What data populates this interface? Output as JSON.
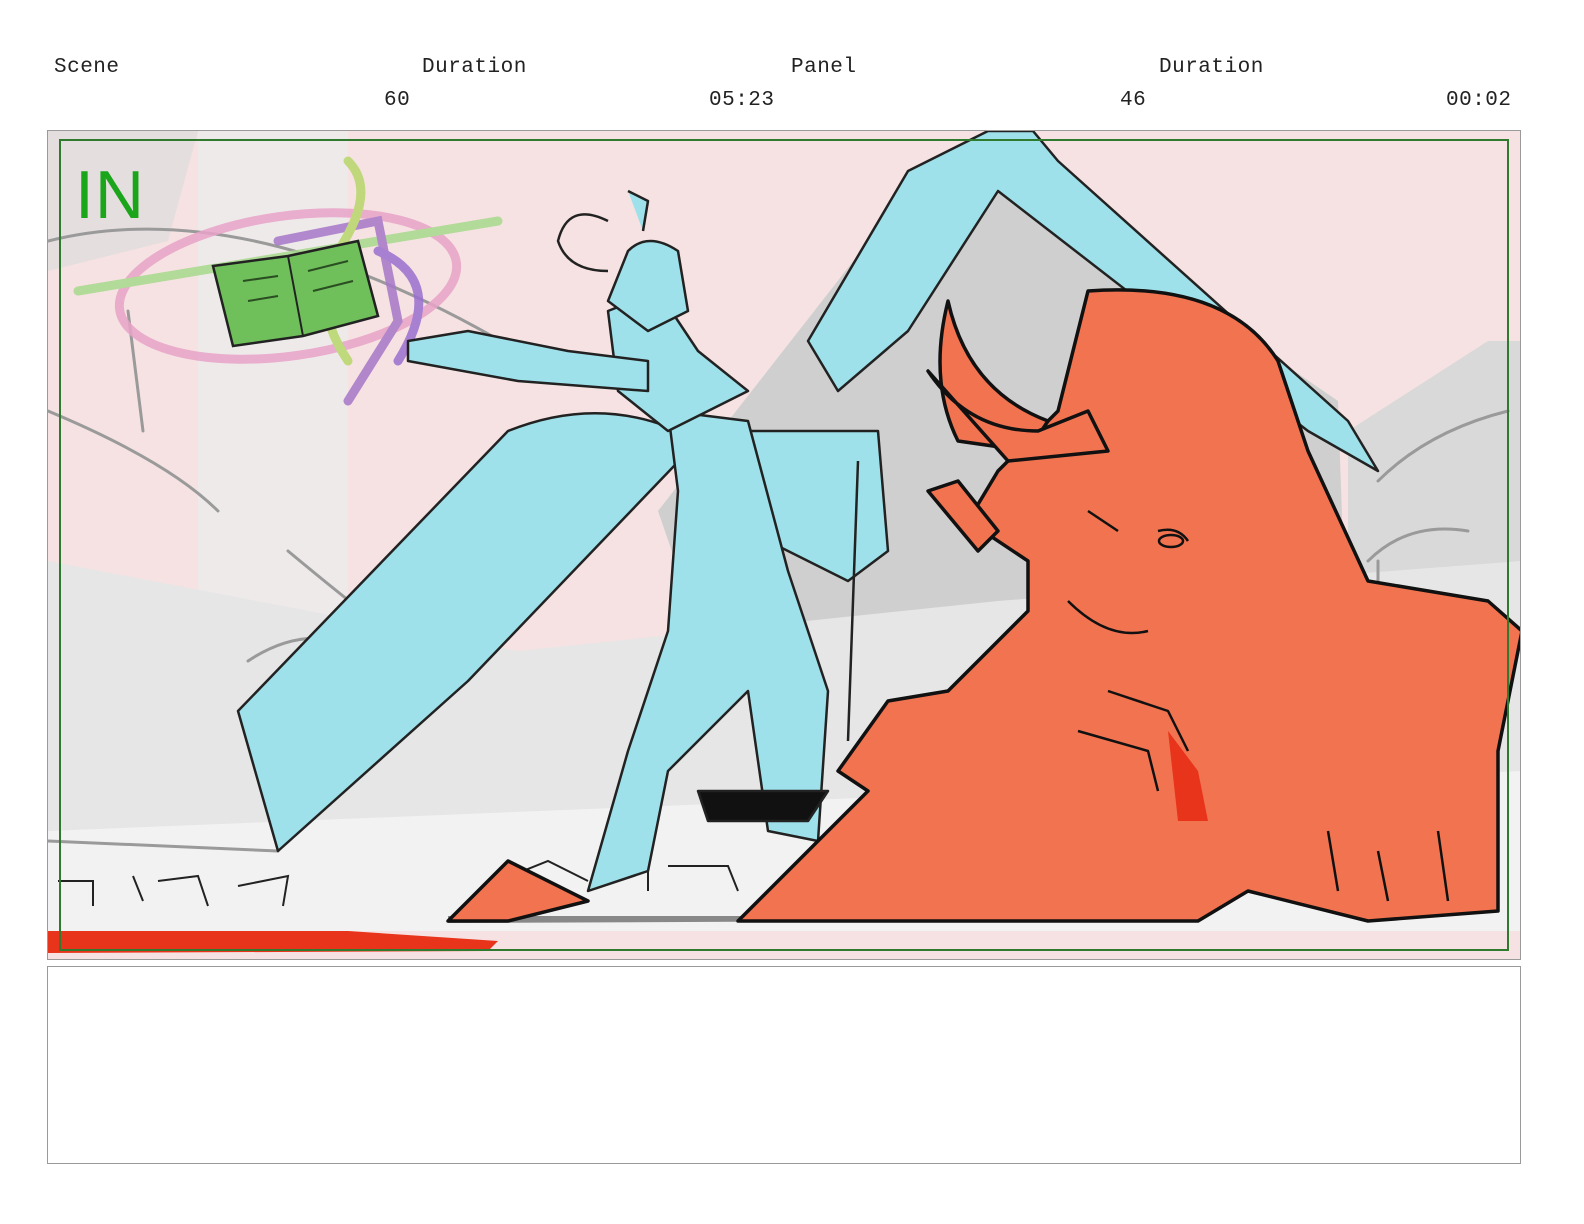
{
  "header": {
    "scene_label": "Scene",
    "scene_value": "60",
    "scene_duration_label": "Duration",
    "scene_duration_value": "05:23",
    "panel_label": "Panel",
    "panel_value": "46",
    "panel_duration_label": "Duration",
    "panel_duration_value": "00:02"
  },
  "panel": {
    "transition_label": "IN",
    "colors": {
      "background": "#f6e2e2",
      "cyan_figure": "#9fe1ea",
      "orange_figure": "#f27350",
      "book": "#6fbf5a",
      "transition_text": "#1aa51a",
      "safe_frame": "#2f7a2f",
      "red_strip": "#e8341a"
    }
  },
  "notes": {
    "text": ""
  }
}
